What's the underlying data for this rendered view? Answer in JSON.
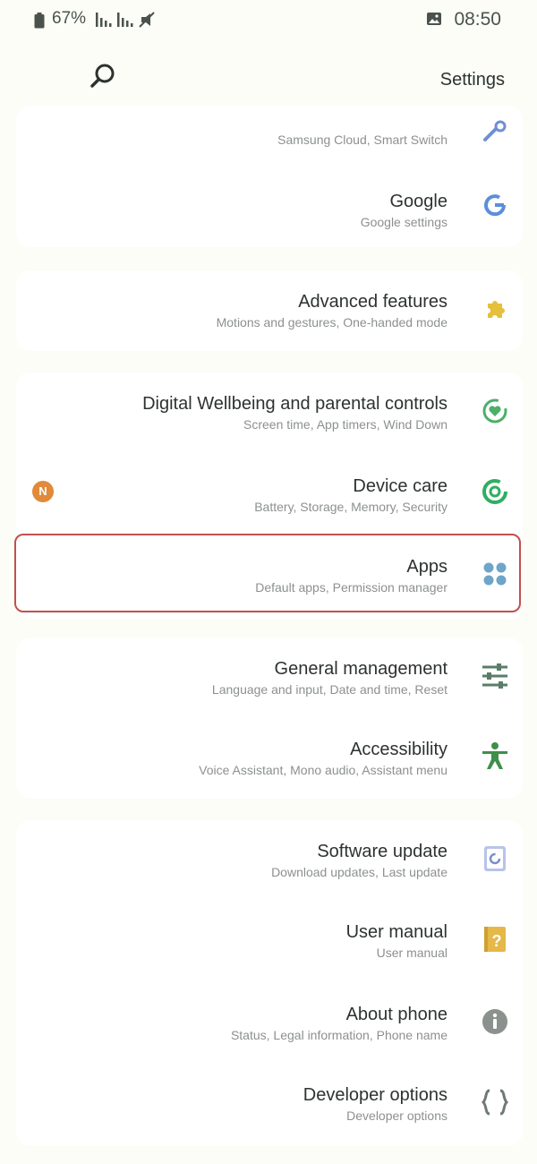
{
  "status_bar": {
    "time": "08:50",
    "battery_percent": "67%",
    "icons": [
      "gallery-icon",
      "battery-icon",
      "signal-icon",
      "signal-icon",
      "mute-icon"
    ]
  },
  "header": {
    "title": "Settings",
    "search_icon": "search-icon"
  },
  "settings": [
    {
      "key": "accounts",
      "label": "",
      "sub": "Samsung Cloud, Smart Switch",
      "icon": "key-icon",
      "color": "#6f8fd4"
    },
    {
      "key": "google",
      "label": "Google",
      "sub": "Google settings",
      "icon": "google-icon",
      "color": "#5b8fd9"
    },
    {
      "key": "advanced",
      "label": "Advanced features",
      "sub": "Motions and gestures, One-handed mode",
      "icon": "puzzle-icon",
      "color": "#e6c03c"
    },
    {
      "key": "wellbeing",
      "label": "Digital Wellbeing and parental controls",
      "sub": "Screen time, App timers, Wind Down",
      "icon": "wellbeing-icon",
      "color": "#4caf6a"
    },
    {
      "key": "device_care",
      "label": "Device care",
      "sub": "Battery, Storage, Memory, Security",
      "icon": "device-care-icon",
      "color": "#2fae62",
      "badge": "N",
      "badge_color": "#e08a3a"
    },
    {
      "key": "apps",
      "label": "Apps",
      "sub": "Default apps, Permission manager",
      "icon": "apps-grid-icon",
      "color": "#6ea5c9"
    },
    {
      "key": "general",
      "label": "General management",
      "sub": "Language and input, Date and time, Reset",
      "icon": "sliders-icon",
      "color": "#5a7d6a"
    },
    {
      "key": "accessibility",
      "label": "Accessibility",
      "sub": "Voice Assistant, Mono audio, Assistant menu",
      "icon": "accessibility-icon",
      "color": "#3f8f4a"
    },
    {
      "key": "software",
      "label": "Software update",
      "sub": "Download updates, Last update",
      "icon": "software-update-icon",
      "color": "#7b8ecc"
    },
    {
      "key": "manual",
      "label": "User manual",
      "sub": "User manual",
      "icon": "manual-icon",
      "color": "#e6b84a"
    },
    {
      "key": "about",
      "label": "About phone",
      "sub": "Status, Legal information, Phone name",
      "icon": "info-icon",
      "color": "#8b918d"
    },
    {
      "key": "developer",
      "label": "Developer options",
      "sub": "Developer options",
      "icon": "braces-icon",
      "color": "#6f7a72"
    }
  ],
  "highlighted_item": "apps"
}
